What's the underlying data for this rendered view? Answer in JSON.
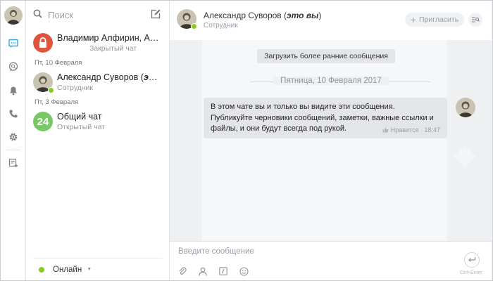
{
  "search": {
    "placeholder": "Поиск"
  },
  "chats": [
    {
      "name": "Владимир Алфирин, Александр Суворов",
      "sub": "Закрытый чат",
      "avatar": "lock-icon",
      "color": "#e0533d"
    },
    {
      "date_separator": "Пт, 10 Февраля",
      "name_plain": "Александр Суворов (",
      "name_em": "это вы",
      "name_close": ")",
      "sub": "Сотрудник",
      "avatar": "portrait",
      "online": true
    },
    {
      "date_separator": "Пт, 3 Февраля",
      "name": "Общий чат",
      "sub": "Открытый чат",
      "avatar_text": "24",
      "color": "#79c866"
    }
  ],
  "status": {
    "label": "Онлайн",
    "color": "#8ac926"
  },
  "header": {
    "name": "Александр Суворов",
    "name_em": "это вы",
    "subtitle": "Сотрудник",
    "invite_label": "Пригласить"
  },
  "messages": {
    "load_earlier": "Загрузить более ранние сообщения",
    "day": "Пятница, 10 Февраля 2017",
    "items": [
      {
        "lines": [
          "В этом чате вы и только вы видите эти сообщения.",
          "Публикуйте черновики сообщений, заметки, важные ссылки и",
          "файлы, и они будут всегда под рукой."
        ],
        "like_label": "Нравится",
        "time": "18:47"
      }
    ]
  },
  "composer": {
    "placeholder": "Введите сообщение",
    "send_hint": "Ctrl+Enter"
  },
  "colors": {
    "accent": "#2fa7df",
    "online": "#8ac926",
    "lock_avatar": "#e0533d",
    "group_avatar": "#79c866"
  }
}
